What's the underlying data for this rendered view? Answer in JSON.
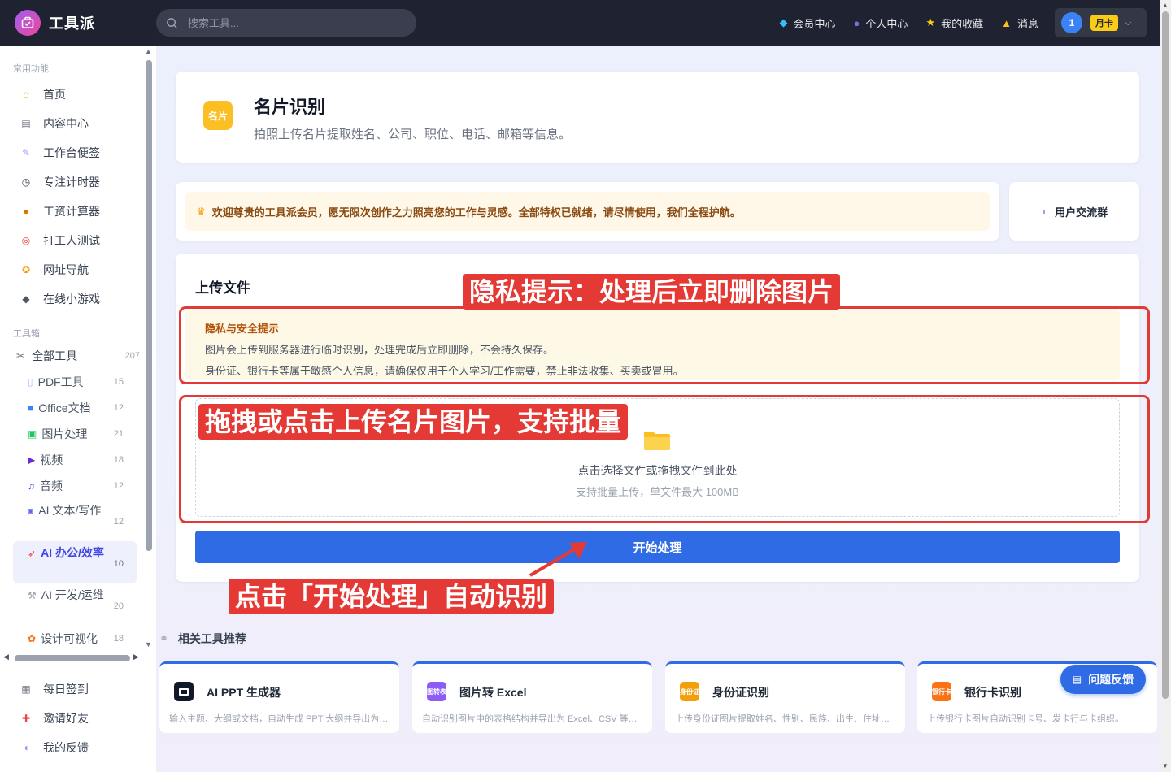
{
  "app": {
    "name": "工具派"
  },
  "search": {
    "placeholder": "搜索工具..."
  },
  "topnav": [
    {
      "label": "会员中心",
      "icon": "diamond-icon"
    },
    {
      "label": "个人中心",
      "icon": "user-icon"
    },
    {
      "label": "我的收藏",
      "icon": "star-icon"
    },
    {
      "label": "消息",
      "icon": "bell-icon"
    }
  ],
  "user": {
    "avatar_text": "1",
    "badge": "月卡"
  },
  "sidebar": {
    "section_common": "常用功能",
    "common": [
      {
        "label": "首页",
        "icon": "home-icon"
      },
      {
        "label": "内容中心",
        "icon": "content-icon"
      },
      {
        "label": "工作台便签",
        "icon": "note-icon"
      },
      {
        "label": "专注计时器",
        "icon": "timer-icon"
      },
      {
        "label": "工资计算器",
        "icon": "money-icon"
      },
      {
        "label": "打工人测试",
        "icon": "target-icon"
      },
      {
        "label": "网址导航",
        "icon": "compass-icon"
      },
      {
        "label": "在线小游戏",
        "icon": "gamepad-icon"
      }
    ],
    "section_tools": "工具箱",
    "all_tools": {
      "label": "全部工具",
      "count": "207"
    },
    "tools": [
      {
        "label": "PDF工具",
        "count": "15"
      },
      {
        "label": "Office文档",
        "count": "12"
      },
      {
        "label": "图片处理",
        "count": "21"
      },
      {
        "label": "视频",
        "count": "18"
      },
      {
        "label": "音频",
        "count": "12"
      },
      {
        "label": "AI 文本/写作",
        "count": "12"
      },
      {
        "label": "AI 办公/效率",
        "count": "10"
      },
      {
        "label": "AI 开发/运维",
        "count": "20"
      },
      {
        "label": "设计可视化",
        "count": "18"
      }
    ],
    "bottom": [
      {
        "label": "每日签到",
        "icon": "calendar-icon"
      },
      {
        "label": "邀请好友",
        "icon": "gift-icon"
      },
      {
        "label": "我的反馈",
        "icon": "chat-icon"
      }
    ]
  },
  "tool_header": {
    "icon_text": "名片",
    "title": "名片识别",
    "subtitle": "拍照上传名片提取姓名、公司、职位、电话、邮箱等信息。"
  },
  "welcome": "欢迎尊贵的工具派会员，愿无限次创作之力照亮您的工作与灵感。全部特权已就绪，请尽情使用，我们全程护航。",
  "user_group": "用户交流群",
  "upload": {
    "title": "上传文件",
    "privacy_title": "隐私与安全提示",
    "privacy_line1": "图片会上传到服务器进行临时识别，处理完成后立即删除，不会持久保存。",
    "privacy_line2": "身份证、银行卡等属于敏感个人信息，请确保仅用于个人学习/工作需要，禁止非法收集、买卖或冒用。",
    "drop_main": "点击选择文件或拖拽文件到此处",
    "drop_sub": "支持批量上传，单文件最大 100MB",
    "start_button": "开始处理"
  },
  "related": {
    "heading": "相关工具推荐",
    "items": [
      {
        "icon_text": "",
        "title": "AI PPT 生成器",
        "desc": "输入主题、大纲或文档，自动生成 PPT 大纲并导出为 PPTX",
        "color": "#111827"
      },
      {
        "icon_text": "图转表",
        "title": "图片转 Excel",
        "desc": "自动识别图片中的表格结构并导出为 Excel、CSV 等格式",
        "color": "#8b5cf6"
      },
      {
        "icon_text": "身份证",
        "title": "身份证识别",
        "desc": "上传身份证图片提取姓名、性别、民族、出生、住址等信息",
        "color": "#f59e0b"
      },
      {
        "icon_text": "银行卡",
        "title": "银行卡识别",
        "desc": "上传银行卡图片自动识别卡号、发卡行与卡组织。",
        "color": "#f97316"
      }
    ]
  },
  "feedback": "问题反馈",
  "annotations": {
    "privacy": "隐私提示：处理后立即删除图片",
    "upload": "拖拽或点击上传名片图片，支持批量",
    "start": "点击「开始处理」自动识别"
  },
  "colors": {
    "topbar": "#1f2230",
    "primary": "#2f6be4",
    "annotation_red": "#e53935",
    "warning_bg": "#fef9e7"
  }
}
